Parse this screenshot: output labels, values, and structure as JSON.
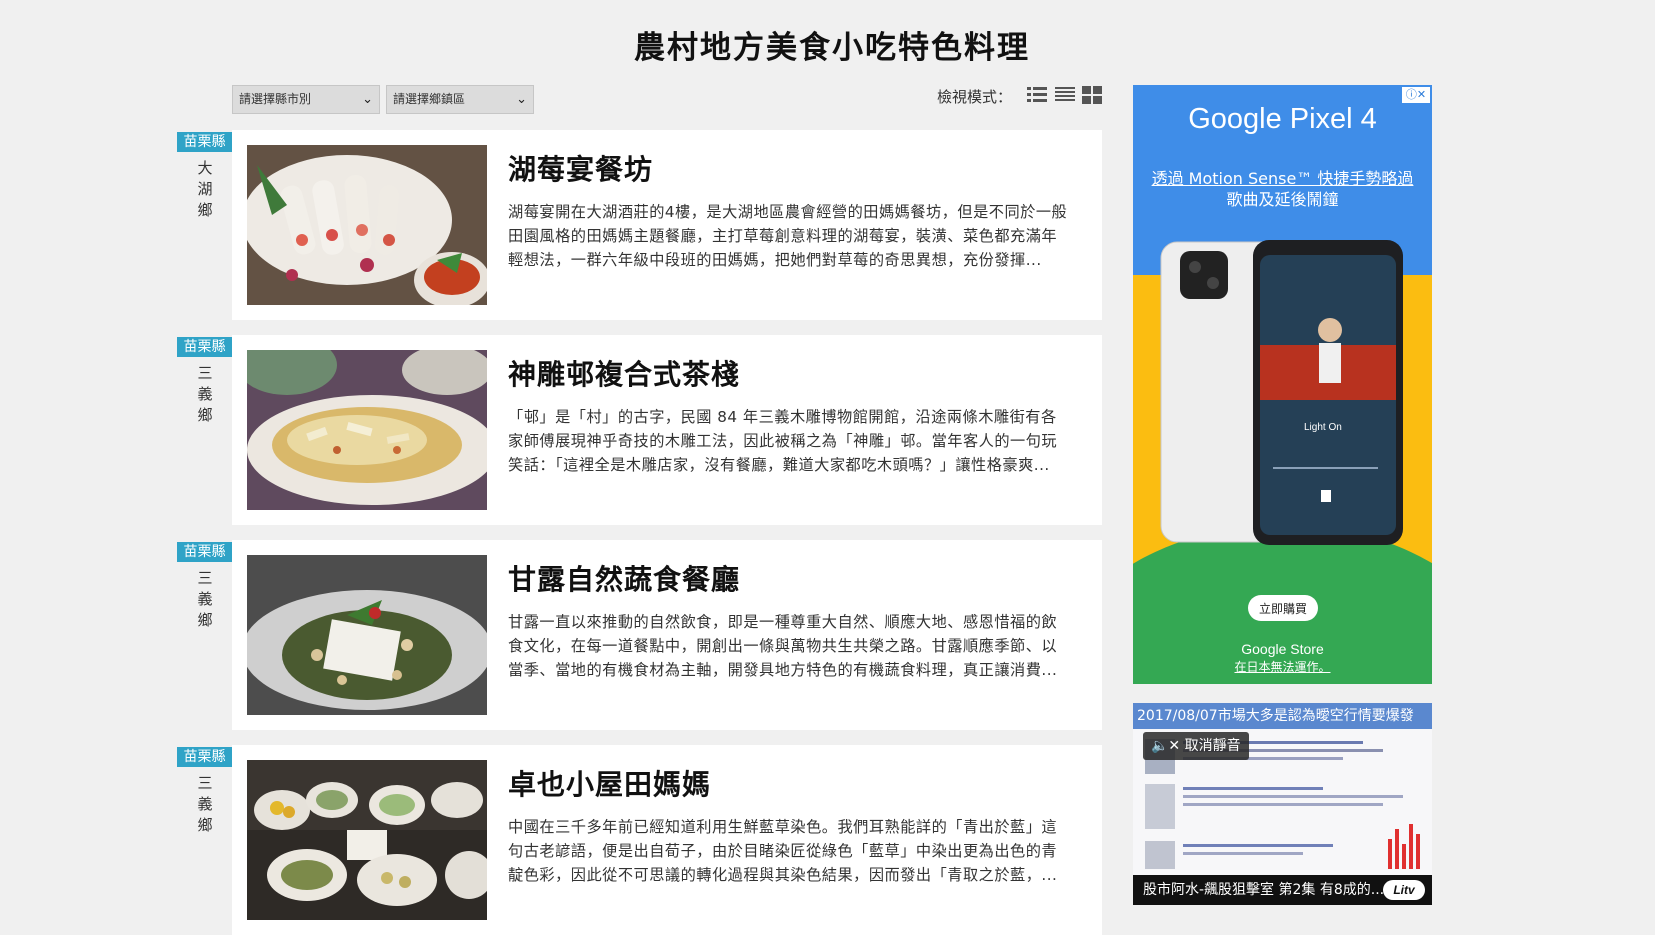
{
  "page": {
    "title": "農村地方美食小吃特色料理"
  },
  "filters": {
    "county": "請選擇縣市別",
    "town": "請選擇鄉鎮區",
    "view_label": "檢視模式："
  },
  "view_icons": [
    "list-detail-icon",
    "list-compact-icon",
    "grid-icon"
  ],
  "cards": [
    {
      "county": "苗栗縣",
      "town": [
        "大",
        "湖",
        "鄉"
      ],
      "title": "湖莓宴餐坊",
      "desc": "湖莓宴開在大湖酒莊的4樓，是大湖地區農會經營的田媽媽餐坊，但是不同於一般田園風格的田媽媽主題餐廳，主打草莓創意料理的湖莓宴，裝潢、菜色都充滿年輕想法，一群六年級中段班的田媽媽，把她們對草莓的奇思異想，充份發揮..."
    },
    {
      "county": "苗栗縣",
      "town": [
        "三",
        "義",
        "鄉"
      ],
      "title": "神雕邨複合式茶棧",
      "desc": "「邨」是「村」的古字，民國 84 年三義木雕博物館開館，沿途兩條木雕街有各家師傅展現神乎奇技的木雕工法，因此被稱之為「神雕」邨。當年客人的一句玩笑話：「這裡全是木雕店家，沒有餐廳，難道大家都吃木頭嗎？」讓性格豪爽..."
    },
    {
      "county": "苗栗縣",
      "town": [
        "三",
        "義",
        "鄉"
      ],
      "title": "甘露自然蔬食餐廳",
      "desc": "甘露一直以來推動的自然飲食，即是一種尊重大自然、順應大地、感恩惜福的飲食文化，在每一道餐點中，開創出一條與萬物共生共榮之路。甘露順應季節、以當季、當地的有機食材為主軸，開發具地方特色的有機蔬食料理，真正讓消費..."
    },
    {
      "county": "苗栗縣",
      "town": [
        "三",
        "義",
        "鄉"
      ],
      "title": "卓也小屋田媽媽",
      "desc": "中國在三千多年前已經知道利用生鮮藍草染色。我們耳熟能詳的「青出於藍」這句古老諺語，便是出自荀子，由於目睹染匠從綠色「藍草」中染出更為出色的青靛色彩，因此從不可思議的轉化過程與其染色結果，因而發出「青取之於藍，..."
    }
  ],
  "ad1": {
    "brand": "Google Pixel 4",
    "line1": "透過 Motion Sense™ 快捷手勢略過",
    "line2": "歌曲及延後鬧鐘",
    "song": "Light On",
    "buy": "立即購買",
    "store": "Google Store",
    "note": "在日本無法運作。"
  },
  "ad2": {
    "headline": "2017/08/07市場大多是認為曖空行情要爆發",
    "unmute": "取消靜音",
    "caption": "股市阿水-飆股狙擊室 第2集 有8成的...",
    "logo": "Litv"
  }
}
